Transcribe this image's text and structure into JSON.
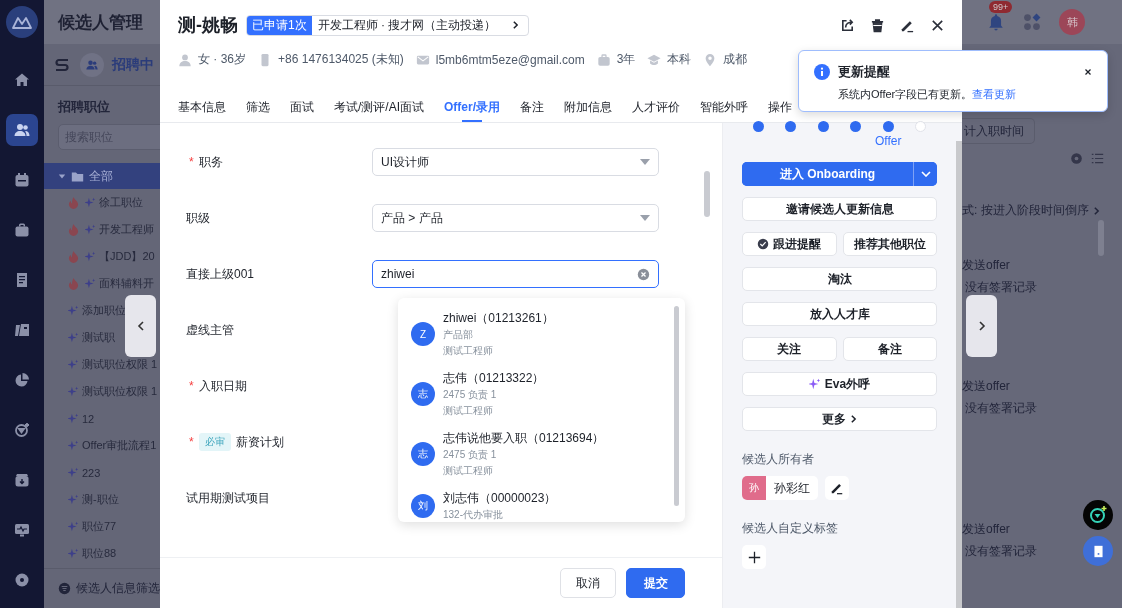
{
  "app": {
    "title": "候选人管理",
    "notification_count": "99+",
    "user_avatar": "韩"
  },
  "nav_rail": [
    {
      "selected": false
    },
    {
      "selected": true
    },
    {
      "selected": false
    },
    {
      "selected": false
    },
    {
      "selected": false
    },
    {
      "selected": false
    },
    {
      "selected": false
    },
    {
      "selected": false
    },
    {
      "selected": false
    },
    {
      "selected": false
    },
    {
      "selected": false
    }
  ],
  "position_panel": {
    "view": "招聘中",
    "title": "招聘职位",
    "search_placeholder": "搜索职位",
    "tree": [
      {
        "label": "全部",
        "expanded": true,
        "selected": true,
        "children": [
          {
            "label": "徐工职位",
            "hot": true
          },
          {
            "label": "开发工程师",
            "hot": true
          },
          {
            "label": "【JDD】20",
            "hot": true
          },
          {
            "label": "面料辅料开",
            "hot": true
          },
          {
            "label": "添加职位",
            "hot": false
          },
          {
            "label": "测试职",
            "hot": false
          },
          {
            "label": "测试职位权限 1",
            "hot": false
          },
          {
            "label": "测试职位权限 1",
            "hot": false
          },
          {
            "label": "12",
            "hot": false
          },
          {
            "label": "Offer审批流程1",
            "hot": false
          },
          {
            "label": "223",
            "hot": false
          },
          {
            "label": "测-职位",
            "hot": false
          },
          {
            "label": "职位77",
            "hot": false
          },
          {
            "label": "职位88",
            "hot": false
          }
        ]
      }
    ],
    "footer": "候选人信息筛选"
  },
  "background_list": {
    "date_button": "计入职时间",
    "sort": "式: 按进入阶段时间倒序",
    "records": [
      {
        "status": "发送offer",
        "signing": "没有签署记录"
      },
      {
        "status": "发送offer",
        "signing": "没有签署记录"
      },
      {
        "status": "发送offer",
        "signing": "没有签署记录"
      }
    ]
  },
  "candidate": {
    "name": "测-姚畅",
    "applied_badge": "已申请1次",
    "application": "开发工程师 · 搜才网（主动投递）",
    "info": [
      {
        "kind": "person",
        "text": "女 · 36岁"
      },
      {
        "kind": "phone",
        "text": "+86 1476134025 (未知)"
      },
      {
        "kind": "mail",
        "text": "l5mb6mtm5eze@gmail.com"
      },
      {
        "kind": "work",
        "text": "3年"
      },
      {
        "kind": "education",
        "text": "本科"
      },
      {
        "kind": "location",
        "text": "成都"
      }
    ]
  },
  "tabs": [
    {
      "label": "基本信息",
      "selected": false
    },
    {
      "label": "筛选",
      "selected": false
    },
    {
      "label": "面试",
      "selected": false
    },
    {
      "label": "考试/测评/AI面试",
      "selected": false
    },
    {
      "label": "Offer/录用",
      "selected": true
    },
    {
      "label": "备注",
      "selected": false
    },
    {
      "label": "附加信息",
      "selected": false
    },
    {
      "label": "人才评价",
      "selected": false
    },
    {
      "label": "智能外呼",
      "selected": false
    },
    {
      "label": "操作",
      "selected": false
    }
  ],
  "form": [
    {
      "label": "职务",
      "required_mark": "*",
      "field": {
        "kind": "select",
        "value": "UI设计师"
      }
    },
    {
      "label": "职级",
      "field": {
        "kind": "select",
        "value": "产品 > 产品"
      }
    },
    {
      "label": "直接上级001",
      "field": {
        "kind": "input",
        "value": "zhiwei",
        "focused": true
      }
    },
    {
      "label": "虚线主管"
    },
    {
      "label": "入职日期",
      "required_mark": "*"
    },
    {
      "label": "薪资计划",
      "required_mark": "*",
      "tag": "必审"
    },
    {
      "label": "试用期测试项目"
    }
  ],
  "suggestions": [
    {
      "avatar": "Z",
      "name": "zhiwei（01213261）",
      "details": [
        "产品部",
        "测试工程师"
      ]
    },
    {
      "avatar": "志",
      "name": "志伟（01213322）",
      "details": [
        "2475 负责 1",
        "测试工程师"
      ]
    },
    {
      "avatar": "志",
      "name": "志伟说他要入职（01213694）",
      "details": [
        "2475 负责 1",
        "测试工程师"
      ]
    },
    {
      "avatar": "刘",
      "name": "刘志伟（00000023）",
      "details": [
        "132-代办审批"
      ]
    }
  ],
  "footer_buttons": [
    {
      "kind": "secondary",
      "label": "取消"
    },
    {
      "kind": "primary",
      "label": "提交"
    }
  ],
  "steps": [
    {
      "done": true
    },
    {
      "done": true
    },
    {
      "done": true
    },
    {
      "done": true
    },
    {
      "done": true,
      "label": "Offer"
    },
    {
      "done": false
    }
  ],
  "actions": [
    [
      {
        "kind": "primary",
        "label": "进入 Onboarding"
      }
    ],
    [
      {
        "kind": "plain",
        "label": "邀请候选人更新信息"
      }
    ],
    [
      {
        "kind": "reminder",
        "label": "跟进提醒"
      },
      {
        "kind": "plain",
        "label": "推荐其他职位"
      }
    ],
    [
      {
        "kind": "plain",
        "label": "淘汰"
      }
    ],
    [
      {
        "kind": "plain",
        "label": "放入人才库"
      }
    ],
    [
      {
        "kind": "plain",
        "label": "关注"
      },
      {
        "kind": "plain",
        "label": "备注"
      }
    ],
    [
      {
        "kind": "ai",
        "label": "Eva外呼"
      }
    ],
    [
      {
        "kind": "more",
        "label": "更多"
      }
    ]
  ],
  "owner": {
    "title": "候选人所有者",
    "avatar": "孙",
    "name": "孙彩红"
  },
  "tags": {
    "title": "候选人自定义标签"
  },
  "notification": {
    "title": "更新提醒",
    "message": "系统内Offer字段已有更新。",
    "link": "查看更新"
  }
}
